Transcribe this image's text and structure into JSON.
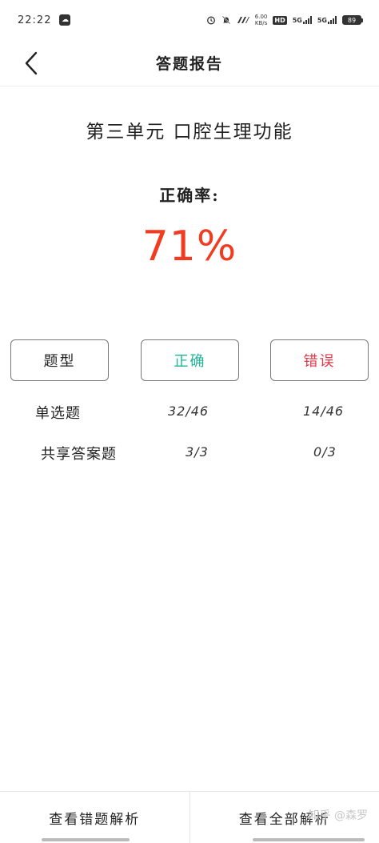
{
  "status_bar": {
    "time": "22:22",
    "app_icon": "cloud-icon",
    "speed_value": "6.00",
    "speed_unit": "KB/s",
    "hd_label": "HD",
    "sim1_label": "5G",
    "sim2_label": "5G",
    "battery_level": "89"
  },
  "nav": {
    "title": "答题报告",
    "back_icon": "chevron-left-icon"
  },
  "report": {
    "unit_title": "第三单元 口腔生理功能",
    "accuracy_label": "正确率:",
    "accuracy_value": "71%"
  },
  "table": {
    "headers": {
      "type": "题型",
      "correct": "正确",
      "wrong": "错误"
    },
    "rows": [
      {
        "name": "单选题",
        "correct": "32/46",
        "wrong": "14/46"
      },
      {
        "name": "共享答案题",
        "correct": "3/3",
        "wrong": "0/3"
      }
    ]
  },
  "bottom": {
    "view_wrong": "查看错题解析",
    "view_all": "查看全部解析"
  },
  "watermark": "知乎 @森罗",
  "colors": {
    "accuracy": "#f23c22",
    "correct": "#1fb597",
    "wrong": "#e03a4a"
  }
}
